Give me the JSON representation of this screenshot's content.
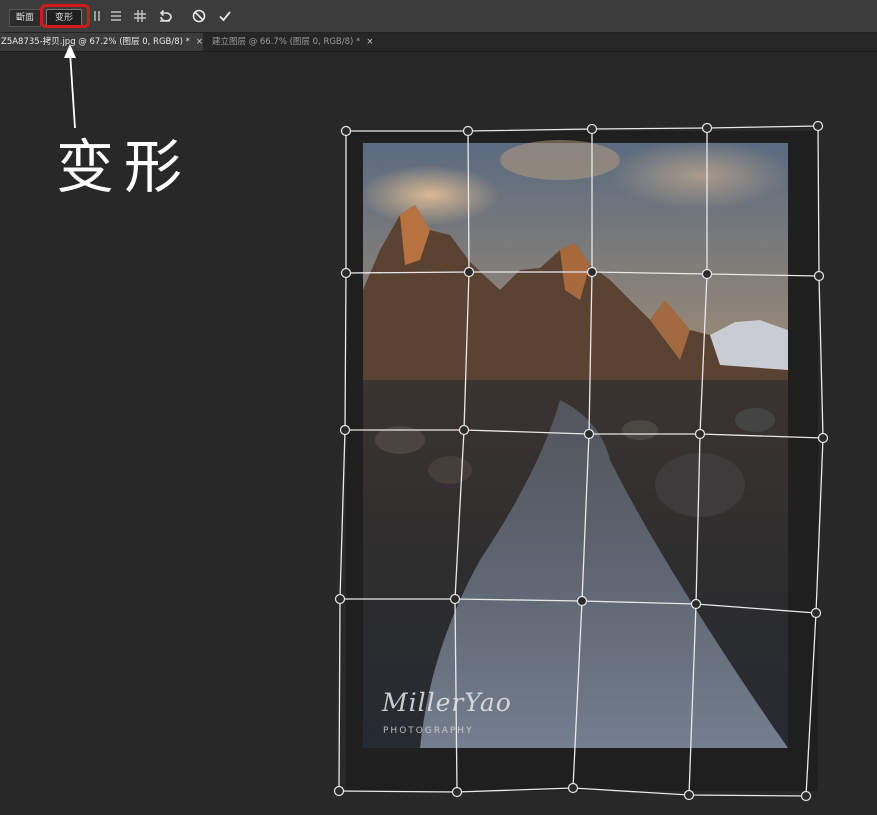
{
  "optionsbar": {
    "split_label": "斷面",
    "warp_label": "变形",
    "icons": [
      "split-vertical-icon",
      "split-horizontal-icon",
      "grid-icon",
      "undo-icon",
      "cancel-icon",
      "commit-icon"
    ],
    "highlight_color": "#d11a1a"
  },
  "tabs": [
    {
      "label": "Z5A8735-拷贝.jpg @ 67.2% (图层 0, RGB/8) *",
      "close": "×",
      "active": true
    },
    {
      "label": "建立图层 @ 66.7% (图层 0, RGB/8) *",
      "close": "×",
      "active": false
    }
  ],
  "annotation": {
    "text": "变形"
  },
  "watermark": {
    "name": "MillerYao",
    "sub": "PHOTOGRAPHY"
  },
  "colors": {
    "canvas": "#282828",
    "grid": "#e8e8e8",
    "annotation": "#ffffff"
  }
}
